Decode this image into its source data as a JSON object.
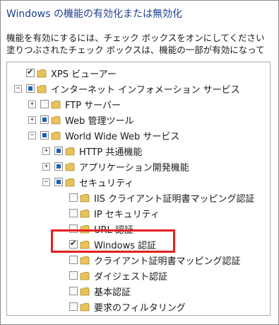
{
  "dialog": {
    "title": "Windows の機能の有効化または無効化",
    "description_line1": "機能を有効にするには、チェック ボックスをオンにしてください",
    "description_line2": "塗りつぶされたチェック ボックスは、機能の一部が有効になって"
  },
  "tree": {
    "items": [
      {
        "label": "XPS ビューアー",
        "state": "checked",
        "expander": "none"
      },
      {
        "label": "インターネット インフォメーション サービス",
        "state": "partial",
        "expander": "minus"
      },
      {
        "label": "FTP サーバー",
        "state": "unchecked",
        "expander": "plus"
      },
      {
        "label": "Web 管理ツール",
        "state": "partial",
        "expander": "plus"
      },
      {
        "label": "World Wide Web サービス",
        "state": "partial",
        "expander": "minus"
      },
      {
        "label": "HTTP 共通機能",
        "state": "partial",
        "expander": "plus"
      },
      {
        "label": "アプリケーション開発機能",
        "state": "partial",
        "expander": "plus"
      },
      {
        "label": "セキュリティ",
        "state": "partial",
        "expander": "minus"
      },
      {
        "label": "IIS クライアント証明書マッピング認証",
        "state": "unchecked",
        "expander": "none"
      },
      {
        "label": "IP セキュリティ",
        "state": "unchecked",
        "expander": "none"
      },
      {
        "label": "URL 認証",
        "state": "unchecked",
        "expander": "none"
      },
      {
        "label": "Windows 認証",
        "state": "checked",
        "expander": "none"
      },
      {
        "label": "クライアント証明書マッピング認証",
        "state": "unchecked",
        "expander": "none"
      },
      {
        "label": "ダイジェスト認証",
        "state": "unchecked",
        "expander": "none"
      },
      {
        "label": "基本認証",
        "state": "unchecked",
        "expander": "none"
      },
      {
        "label": "要求のフィルタリング",
        "state": "unchecked",
        "expander": "none"
      }
    ]
  },
  "colors": {
    "title": "#1e3f8c",
    "partial_fill": "#1f5fc0",
    "highlight_box": "#e2201f",
    "folder": "#e8c25a"
  },
  "icons": {
    "folder": "folder-icon",
    "expand": "plus-expander-icon",
    "collapse": "minus-expander-icon"
  }
}
